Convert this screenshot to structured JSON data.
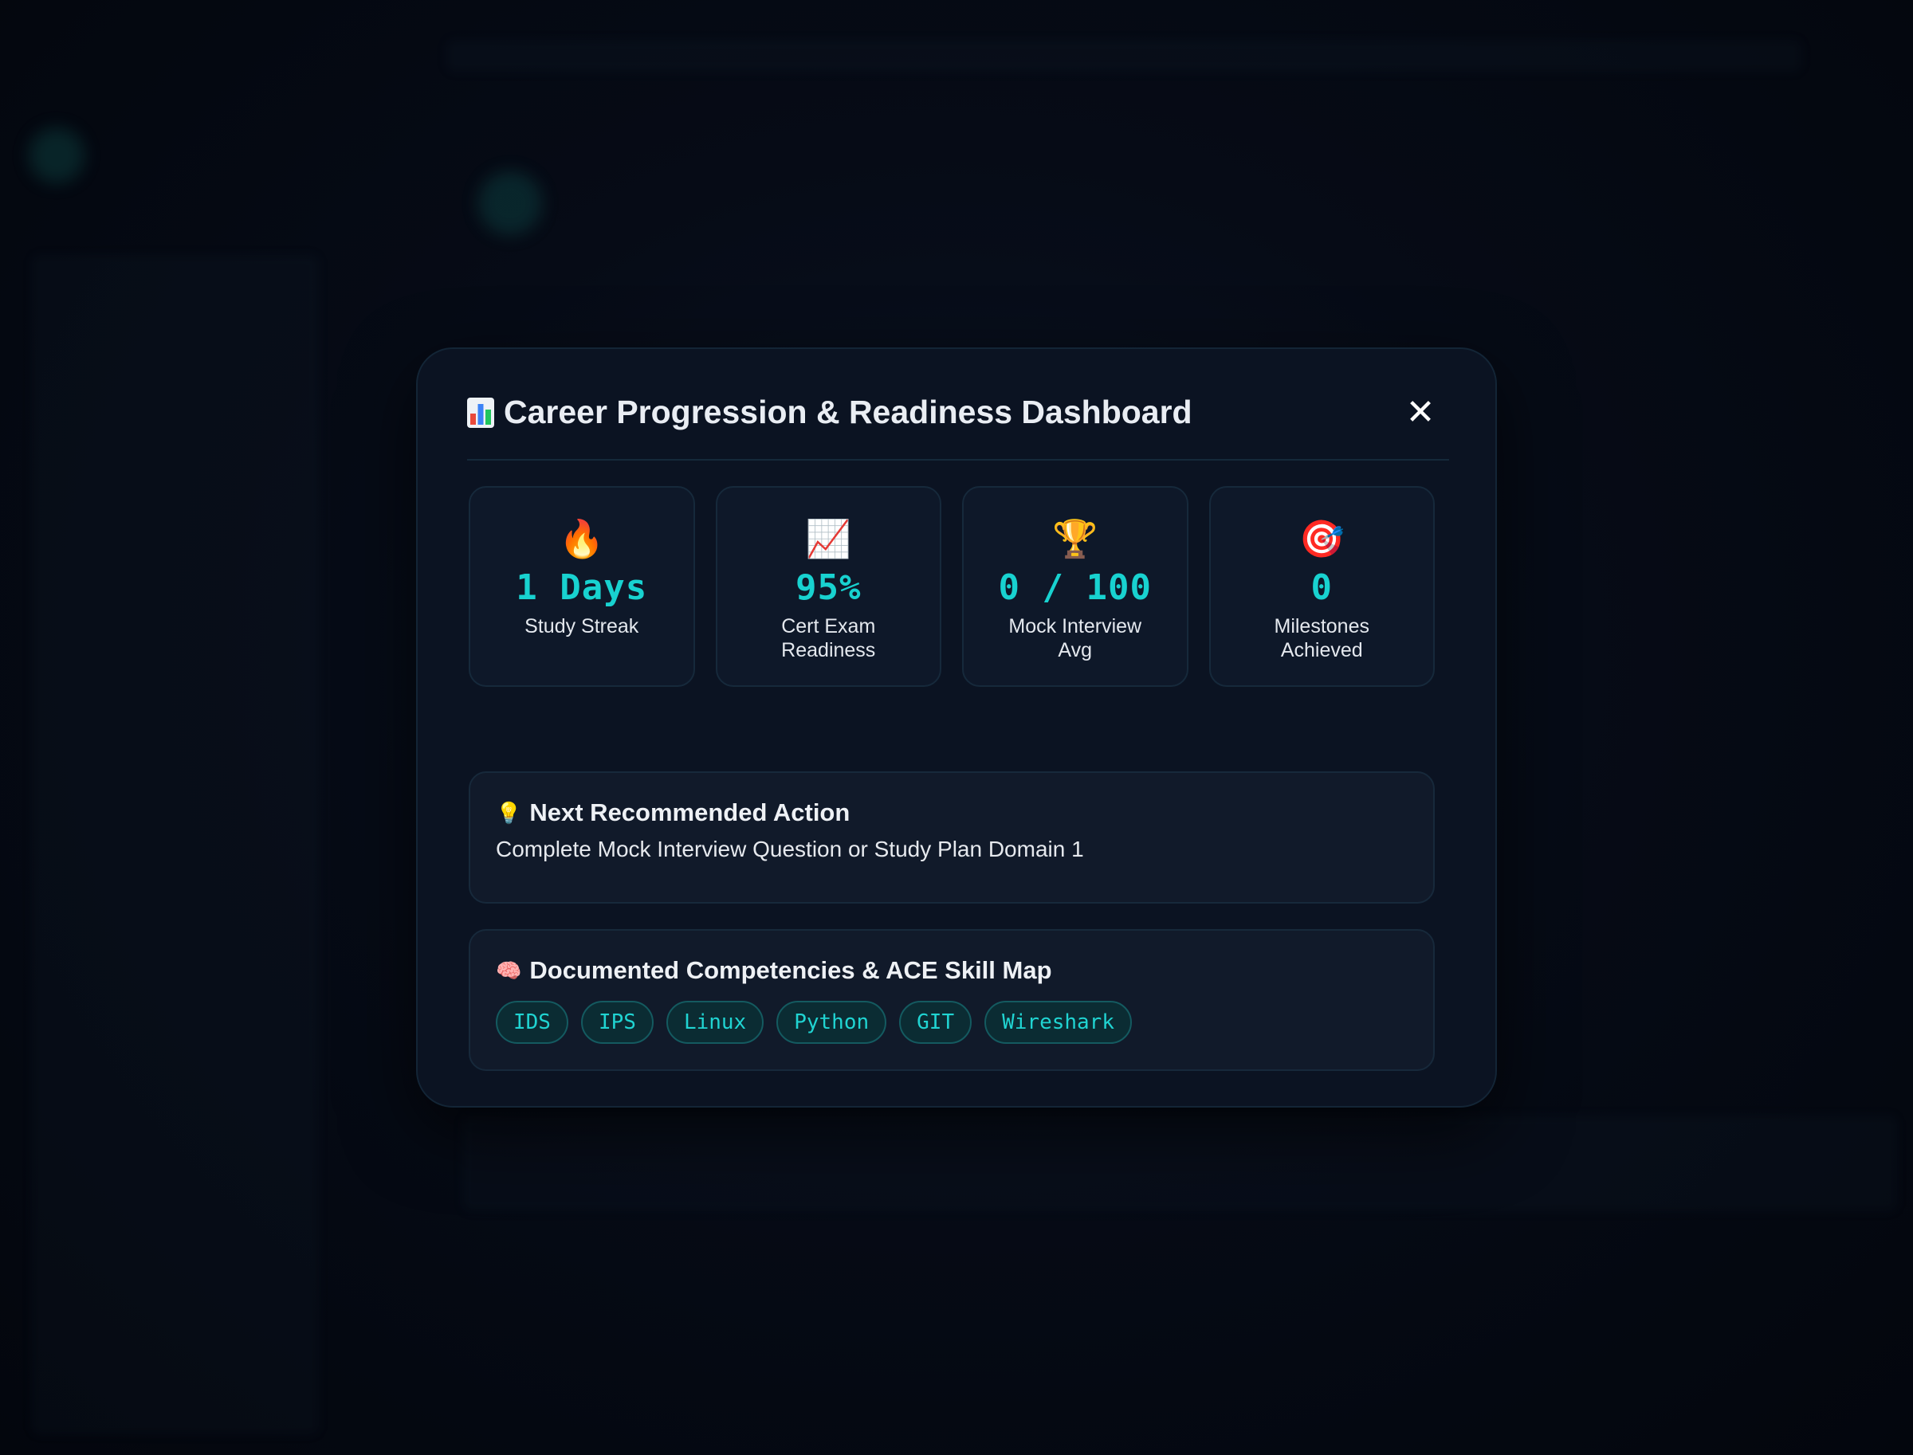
{
  "modal": {
    "title": "Career Progression & Readiness Dashboard",
    "title_icon": "bar-chart-icon",
    "close_label": "✕"
  },
  "stats": [
    {
      "emoji": "🔥",
      "icon": "fire-icon",
      "value": "1 Days",
      "label": "Study Streak"
    },
    {
      "emoji": "📈",
      "icon": "trend-up-icon",
      "value": "95%",
      "label": "Cert Exam Readiness"
    },
    {
      "emoji": "🏆",
      "icon": "trophy-icon",
      "value": "0 / 100",
      "label": "Mock Interview Avg"
    },
    {
      "emoji": "🎯",
      "icon": "target-icon",
      "value": "0",
      "label": "Milestones Achieved"
    }
  ],
  "next_action": {
    "icon": "💡",
    "heading": "Next Recommended Action",
    "text": "Complete Mock Interview Question or Study Plan Domain 1"
  },
  "skills": {
    "icon": "🧠",
    "heading": "Documented Competencies & ACE Skill Map",
    "tags": [
      "IDS",
      "IPS",
      "Linux",
      "Python",
      "GIT",
      "Wireshark"
    ]
  },
  "colors": {
    "accent": "#18d2d0",
    "modal_bg": "#0b1322",
    "card_bg": "#0e1829"
  }
}
